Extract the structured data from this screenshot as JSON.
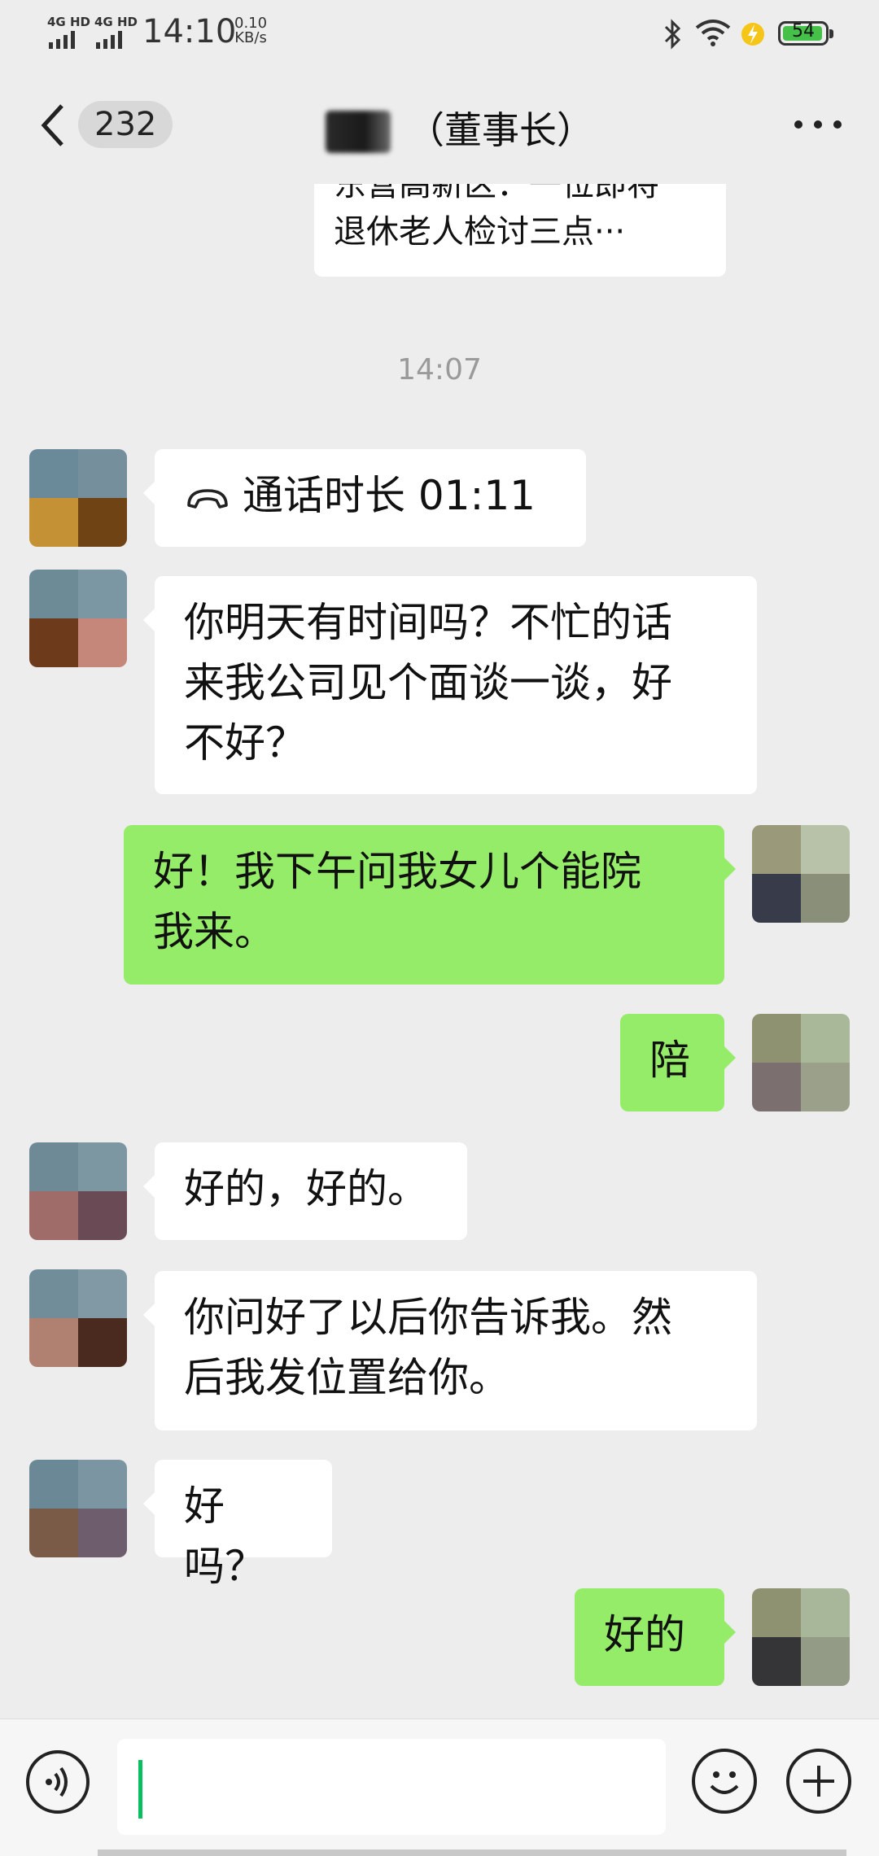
{
  "status_bar": {
    "signal1_label": "4G HD",
    "signal2_label": "4G HD",
    "time": "14:10",
    "net_speed_value": "0.10",
    "net_speed_unit": "KB/s",
    "battery_level": "54",
    "icons": [
      "bluetooth-icon",
      "wifi-icon",
      "charging-icon",
      "battery-icon"
    ]
  },
  "header": {
    "back_icon": "chevron-left-icon",
    "unread_count": "232",
    "title": "（董事长）",
    "more_icon": "more-dots-icon"
  },
  "chat": {
    "partial_message_lines": [
      "东营高新区：一位即将",
      "退休老人检讨三点···"
    ],
    "time_separator": "14:07",
    "messages": [
      {
        "side": "left",
        "type": "call",
        "icon": "phone-hangup-icon",
        "text": "通话时长 01:11"
      },
      {
        "side": "left",
        "text": "你明天有时间吗？不忙的话\n来我公司见个面谈一谈，好\n不好？"
      },
      {
        "side": "right",
        "text": "好！我下午问我女儿个能院\n我来。"
      },
      {
        "side": "right",
        "text": "陪"
      },
      {
        "side": "left",
        "text": "好的，好的。"
      },
      {
        "side": "left",
        "text": "你问好了以后你告诉我。然\n后我发位置给你。"
      },
      {
        "side": "left",
        "text": "好吗？"
      },
      {
        "side": "right",
        "text": "好的"
      }
    ]
  },
  "input_bar": {
    "voice_icon": "voice-input-icon",
    "input_value": "",
    "emoji_icon": "emoji-icon",
    "plus_icon": "plus-icon"
  },
  "colors": {
    "background": "#ededed",
    "sent_bubble": "#95ec69",
    "received_bubble": "#ffffff",
    "caret": "#07c160"
  }
}
